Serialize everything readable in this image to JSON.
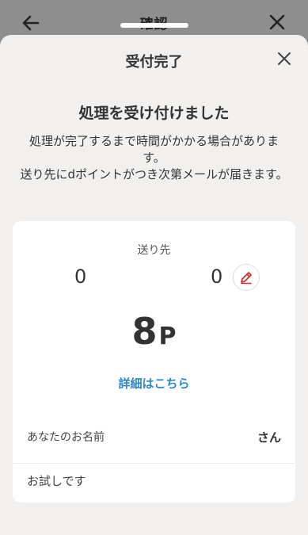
{
  "background_header": {
    "title": "確認",
    "back_icon": "arrow-left-icon",
    "close_icon": "close-icon"
  },
  "sheet": {
    "title": "受付完了",
    "close_icon": "close-icon",
    "heading": "処理を受け付けました",
    "message": "処理が完了するまで時間がかかる場合があります。\n送り先にdポイントがつき次第メールが届きます。"
  },
  "card": {
    "recipient_label": "送り先",
    "left_number": "0",
    "right_number": "0",
    "edit_icon": "pencil-icon",
    "points_value": "8",
    "points_unit": "P",
    "details_link": "詳細はこちら",
    "name_label": "あなたのお名前",
    "name_value": "さん",
    "message_text": "お試しです"
  },
  "colors": {
    "link": "#2a8ac8",
    "edit_icon": "#d0312d",
    "sheet_bg": "#f1f0ef",
    "card_bg": "#ffffff"
  }
}
